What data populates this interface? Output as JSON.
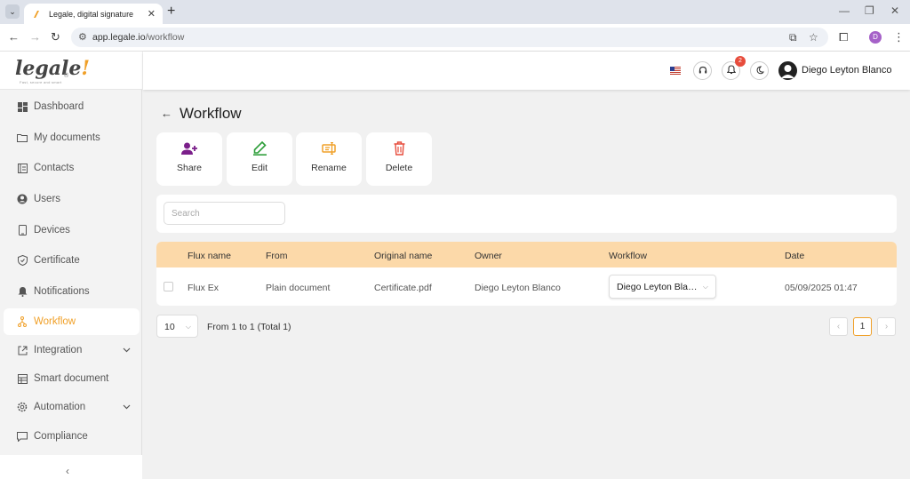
{
  "browser": {
    "tab_title": "Legale, digital signature",
    "url_host": "app.legale.io",
    "url_path": "/workflow",
    "profile_initial": "D"
  },
  "logo": {
    "text": "legale",
    "mark": "!",
    "reg": "®",
    "tagline": "Fast, secure and smart"
  },
  "sidebar": {
    "items": [
      {
        "label": "Dashboard",
        "icon": "dashboard-icon"
      },
      {
        "label": "My documents",
        "icon": "folder-icon"
      },
      {
        "label": "Contacts",
        "icon": "contacts-icon"
      },
      {
        "label": "Users",
        "icon": "user-icon"
      },
      {
        "label": "Devices",
        "icon": "device-icon"
      },
      {
        "label": "Certificate",
        "icon": "shield-icon"
      },
      {
        "label": "Notifications",
        "icon": "bell-icon"
      },
      {
        "label": "Workflow",
        "icon": "workflow-icon"
      },
      {
        "label": "Integration",
        "icon": "external-link-icon"
      },
      {
        "label": "Smart document",
        "icon": "document-grid-icon"
      },
      {
        "label": "Automation",
        "icon": "gear-icon"
      },
      {
        "label": "Compliance",
        "icon": "chat-icon"
      }
    ],
    "collapse_glyph": "‹"
  },
  "header": {
    "notification_count": "2",
    "user_name": "Diego Leyton Blanco"
  },
  "page": {
    "title": "Workflow"
  },
  "actions": {
    "share": "Share",
    "edit": "Edit",
    "rename": "Rename",
    "delete": "Delete"
  },
  "search": {
    "placeholder": "Search"
  },
  "table": {
    "headers": {
      "flux_name": "Flux name",
      "from": "From",
      "original_name": "Original name",
      "owner": "Owner",
      "workflow": "Workflow",
      "date": "Date"
    },
    "rows": [
      {
        "flux_name": "Flux Ex",
        "from": "Plain document",
        "original_name": "Certificate.pdf",
        "owner": "Diego Leyton Blanco",
        "workflow": "Diego Leyton Blanc...",
        "date": "05/09/2025 01:47"
      }
    ]
  },
  "pagination": {
    "page_size": "10",
    "range_text": "From 1 to 1 (Total 1)",
    "current_page": "1"
  },
  "colors": {
    "accent": "#f0a028",
    "table_header": "#fcd9a9",
    "share_icon": "#7b1f8a",
    "edit_icon": "#2e9e3a",
    "rename_icon": "#f0a028",
    "delete_icon": "#e74c3c"
  }
}
